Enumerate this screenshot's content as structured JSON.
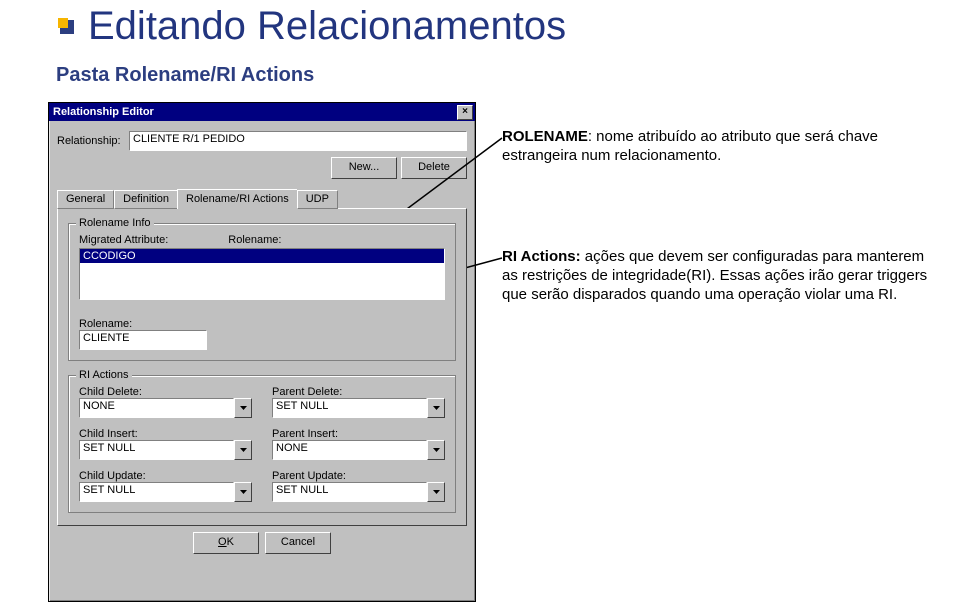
{
  "slide": {
    "title": "Editando Relacionamentos",
    "subtitle": "Pasta Rolename/RI Actions"
  },
  "dialog": {
    "title": "Relationship Editor",
    "close_glyph": "×",
    "relationship_label": "Relationship:",
    "relationship_value": "CLIENTE R/1 PEDIDO",
    "buttons": {
      "new": "New...",
      "delete": "Delete",
      "ok": "OK",
      "cancel": "Cancel"
    },
    "tabs": [
      "General",
      "Definition",
      "Rolename/RI Actions",
      "UDP"
    ],
    "active_tab": 2,
    "rolename_info": {
      "legend": "Rolename Info",
      "migrated_label": "Migrated Attribute:",
      "rolename_label": "Rolename:",
      "list_selected": "CCODIGO",
      "rolename_field_label": "Rolename:",
      "rolename_value": "CLIENTE"
    },
    "ri_actions": {
      "legend": "RI Actions",
      "rows": [
        {
          "child_label": "Child Delete:",
          "child_value": "NONE",
          "parent_label": "Parent Delete:",
          "parent_value": "SET NULL"
        },
        {
          "child_label": "Child Insert:",
          "child_value": "SET NULL",
          "parent_label": "Parent Insert:",
          "parent_value": "NONE"
        },
        {
          "child_label": "Child Update:",
          "child_value": "SET NULL",
          "parent_label": "Parent Update:",
          "parent_value": "SET NULL"
        }
      ]
    }
  },
  "annotations": {
    "rolename": "ROLENAME: nome atribuído ao atributo que será chave estrangeira  num relacionamento.",
    "ri_actions": "RI Actions: ações que devem ser configuradas para manterem as restrições de integridade(RI). Essas ações irão gerar triggers que serão disparados quando uma operação violar uma RI."
  }
}
